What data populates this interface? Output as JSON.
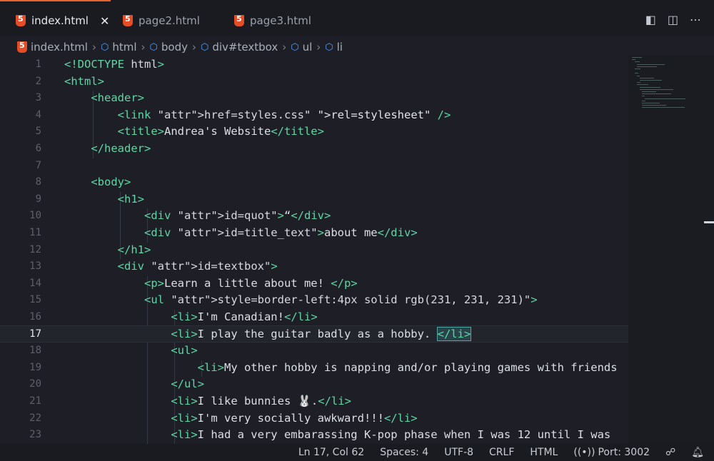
{
  "tabs": [
    {
      "label": "index.html",
      "active": true
    },
    {
      "label": "page2.html",
      "active": false
    },
    {
      "label": "page3.html",
      "active": false
    }
  ],
  "breadcrumb": [
    "index.html",
    "html",
    "body",
    "div#textbox",
    "ul",
    "li"
  ],
  "editor": {
    "current_line": 17,
    "lines": [
      {
        "n": "1",
        "text": "<!DOCTYPE html>"
      },
      {
        "n": "2",
        "text": "<html>"
      },
      {
        "n": "3",
        "text": "    <header>"
      },
      {
        "n": "4",
        "text": "        <link href=\"styles.css\" rel=\"stylesheet\" />"
      },
      {
        "n": "5",
        "text": "        <title>Andrea's Website</title>"
      },
      {
        "n": "6",
        "text": "    </header>"
      },
      {
        "n": "7",
        "text": ""
      },
      {
        "n": "8",
        "text": "    <body>"
      },
      {
        "n": "9",
        "text": "        <h1>"
      },
      {
        "n": "10",
        "text": "            <div id=\"quot\">“</div>"
      },
      {
        "n": "11",
        "text": "            <div id=\"title_text\">about me</div>"
      },
      {
        "n": "12",
        "text": "        </h1>"
      },
      {
        "n": "13",
        "text": "        <div id=\"textbox\">"
      },
      {
        "n": "14",
        "text": "            <p>Learn a little about me! </p>"
      },
      {
        "n": "15",
        "text": "            <ul style=\"border-left:4px solid rgb(231, 231, 231)\">"
      },
      {
        "n": "16",
        "text": "                <li>I'm Canadian!</li>"
      },
      {
        "n": "17",
        "text": "                <li>I play the guitar badly as a hobby. </li>"
      },
      {
        "n": "18",
        "text": "                <ul>"
      },
      {
        "n": "19",
        "text": "                    <li>My other hobby is napping and/or playing games with friends"
      },
      {
        "n": "20",
        "text": "                </ul>"
      },
      {
        "n": "21",
        "text": "                <li>I like bunnies 🐰.</li>"
      },
      {
        "n": "22",
        "text": "                <li>I'm very socially awkward!!!</li>"
      },
      {
        "n": "23",
        "text": "                <li>I had a very embarassing K-pop phase when I was 12 until I was"
      }
    ]
  },
  "status": {
    "position": "Ln 17, Col 62",
    "spaces": "Spaces: 4",
    "encoding": "UTF-8",
    "eol": "CRLF",
    "language": "HTML",
    "port": "Port: 3002"
  },
  "colors": {
    "tag": "#5fd7a3",
    "attr": "#c792ea",
    "html_icon": "#e44d26",
    "tab_accent": "#e8632b"
  },
  "icons": [
    "html5-icon",
    "close-icon",
    "split-preview-icon",
    "split-editor-icon",
    "more-icon",
    "element-cube-icon",
    "broadcast-icon",
    "feedback-icon",
    "bell-icon"
  ]
}
